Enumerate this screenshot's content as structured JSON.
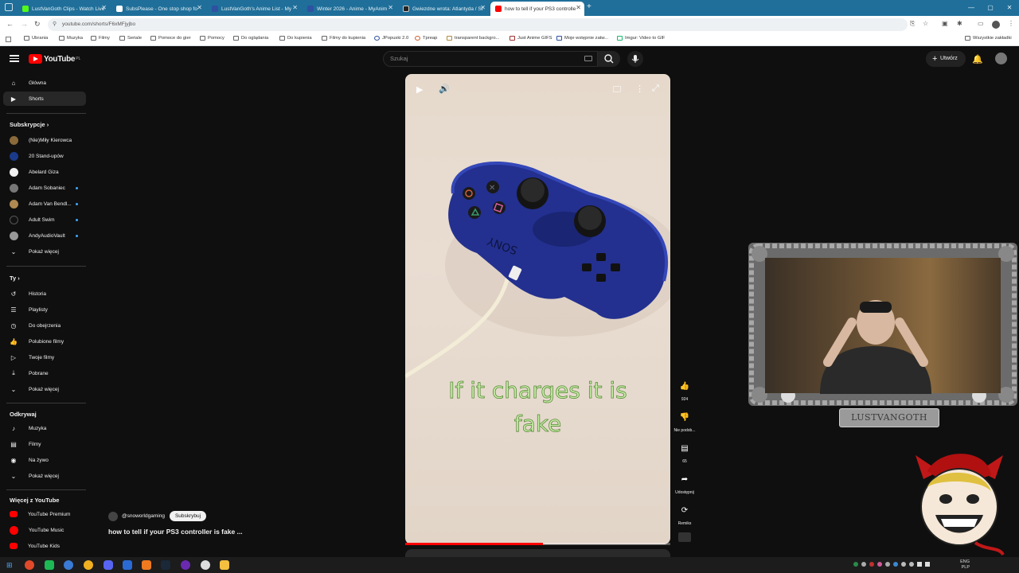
{
  "browser": {
    "tabs": [
      {
        "label": "LustVanGoth Clips - Watch Live",
        "color": "#53fc18"
      },
      {
        "label": "SubsPlease - One stop shop fo",
        "color": "#ffffff"
      },
      {
        "label": "LustVanGoth's Anime List - My",
        "color": "#2e51a2"
      },
      {
        "label": "Winter 2026 - Anime - MyAnim",
        "color": "#2e51a2"
      },
      {
        "label": "Gwiezdne wrota: Atlantyda / St",
        "color": "#222222"
      },
      {
        "label": "how to tell if your PS3 controlle",
        "color": "#ff0000"
      }
    ],
    "url": "youtube.com/shorts/F6xMFjyjbo",
    "bookmarks": [
      "Ubrania",
      "Muzyka",
      "Filmy",
      "Seriale",
      "Pomoce do gier",
      "Pomocy",
      "Do oglądania",
      "Do kupienia",
      "Filmy do kupienia",
      "JPopuski 2.0",
      "Tpreap",
      "transparent backgro...",
      "Just Anime GIFS",
      "Moje wstępnie zatw...",
      "Imgur: Video to GIF"
    ],
    "bookmarks_all": "Wszystkie zakładki"
  },
  "youtube": {
    "logo_text": "YouTube",
    "logo_region": "PL",
    "search_placeholder": "Szukaj",
    "create_label": "Utwórz"
  },
  "sidebar": {
    "main": [
      {
        "label": "Główna",
        "icon": "home-icon"
      },
      {
        "label": "Shorts",
        "icon": "shorts-icon"
      }
    ],
    "subscriptions_heading": "Subskrypcje",
    "subscriptions": [
      {
        "label": "(Nie)Miły Kierowca",
        "color": "#8a6a3a",
        "dot": false
      },
      {
        "label": "20 Stand-upów",
        "color": "#1a3a8a",
        "dot": false
      },
      {
        "label": "Abelard Giza",
        "color": "#f1f1f1",
        "dot": false
      },
      {
        "label": "Adam Sobaniec",
        "color": "#777777",
        "dot": true
      },
      {
        "label": "Adam Van Bendl...",
        "color": "#b08a50",
        "dot": true
      },
      {
        "label": "Adult Swim",
        "color": "#111111",
        "dot": true
      },
      {
        "label": "AndyAudioVault",
        "color": "#999999",
        "dot": true
      }
    ],
    "show_more": "Pokaż więcej",
    "you_heading": "Ty",
    "you": [
      {
        "label": "Historia",
        "icon": "history-icon"
      },
      {
        "label": "Playlisty",
        "icon": "playlists-icon"
      },
      {
        "label": "Do obejrzenia",
        "icon": "watch-later-icon"
      },
      {
        "label": "Polubione filmy",
        "icon": "thumbs-up-icon"
      },
      {
        "label": "Twoje filmy",
        "icon": "your-videos-icon"
      },
      {
        "label": "Pobrane",
        "icon": "download-icon"
      }
    ],
    "explore_heading": "Odkrywaj",
    "explore": [
      {
        "label": "Muzyka",
        "icon": "music-icon"
      },
      {
        "label": "Filmy",
        "icon": "film-icon"
      },
      {
        "label": "Na żywo",
        "icon": "live-icon"
      }
    ],
    "more_heading": "Więcej z YouTube",
    "more": [
      {
        "label": "YouTube Premium"
      },
      {
        "label": "YouTube Music"
      },
      {
        "label": "YouTube Kids"
      }
    ]
  },
  "short": {
    "overlay_caption_line1": "If it charges it is",
    "overlay_caption_line2": "fake",
    "progress_fraction": 0.52,
    "channel_handle": "@snoworldgaming",
    "subscribe_label": "Subskrybuj",
    "title": "how to tell if your PS3 controller is fake ...",
    "controller_brand": "SONY",
    "actions": {
      "likes": "924",
      "dislike_label": "Nie podob...",
      "comments": "65",
      "share_label": "Udostępnij",
      "remix_label": "Remiks"
    }
  },
  "webcam": {
    "nameplate": "LUSTVANGOTH"
  },
  "taskbar": {
    "lang_line1": "ENG",
    "lang_line2": "PLP"
  }
}
